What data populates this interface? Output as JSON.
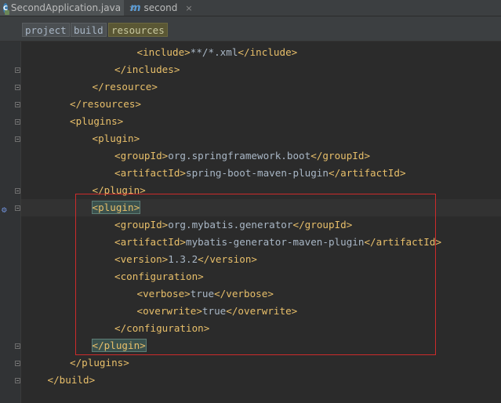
{
  "tabs": [
    {
      "label": "SecondApplication.java",
      "icon": "spring-class-icon",
      "close": "×",
      "active": true
    },
    {
      "label": "second",
      "icon": "maven-module-icon",
      "icon_glyph": "m",
      "close": "×",
      "active": false
    }
  ],
  "breadcrumb": [
    "project",
    "build",
    "resources"
  ],
  "code_lines": [
    {
      "indent": 5,
      "parts": [
        [
          "t",
          "<include>"
        ],
        [
          "x",
          "**/*.xml"
        ],
        [
          "t",
          "</include>"
        ]
      ]
    },
    {
      "indent": 4,
      "parts": [
        [
          "t",
          "</includes>"
        ]
      ]
    },
    {
      "indent": 3,
      "parts": [
        [
          "t",
          "</resource>"
        ]
      ]
    },
    {
      "indent": 2,
      "parts": [
        [
          "t",
          "</resources>"
        ]
      ]
    },
    {
      "indent": 2,
      "parts": [
        [
          "t",
          "<plugins>"
        ]
      ]
    },
    {
      "indent": 3,
      "parts": [
        [
          "t",
          "<plugin>"
        ]
      ]
    },
    {
      "indent": 4,
      "parts": [
        [
          "t",
          "<groupId>"
        ],
        [
          "x",
          "org.springframework.boot"
        ],
        [
          "t",
          "</groupId>"
        ]
      ]
    },
    {
      "indent": 4,
      "parts": [
        [
          "t",
          "<artifactId>"
        ],
        [
          "x",
          "spring-boot-maven-plugin"
        ],
        [
          "t",
          "</artifactId>"
        ]
      ]
    },
    {
      "indent": 3,
      "parts": [
        [
          "t",
          "</plugin>"
        ]
      ]
    },
    {
      "indent": 3,
      "parts": [
        [
          "h",
          "<plugin>"
        ]
      ]
    },
    {
      "indent": 4,
      "parts": [
        [
          "t",
          "<groupId>"
        ],
        [
          "x",
          "org.mybatis.generator"
        ],
        [
          "t",
          "</groupId>"
        ]
      ]
    },
    {
      "indent": 4,
      "parts": [
        [
          "t",
          "<artifactId>"
        ],
        [
          "x",
          "mybatis-generator-maven-plugin"
        ],
        [
          "t",
          "</artifactId>"
        ]
      ]
    },
    {
      "indent": 4,
      "parts": [
        [
          "t",
          "<version>"
        ],
        [
          "x",
          "1.3.2"
        ],
        [
          "t",
          "</version>"
        ]
      ]
    },
    {
      "indent": 4,
      "parts": [
        [
          "t",
          "<configuration>"
        ]
      ]
    },
    {
      "indent": 5,
      "parts": [
        [
          "t",
          "<verbose>"
        ],
        [
          "x",
          "true"
        ],
        [
          "t",
          "</verbose>"
        ]
      ]
    },
    {
      "indent": 5,
      "parts": [
        [
          "t",
          "<overwrite>"
        ],
        [
          "x",
          "true"
        ],
        [
          "t",
          "</overwrite>"
        ]
      ]
    },
    {
      "indent": 4,
      "parts": [
        [
          "t",
          "</configuration>"
        ]
      ]
    },
    {
      "indent": 3,
      "parts": [
        [
          "h",
          "</plugin>"
        ]
      ]
    },
    {
      "indent": 2,
      "parts": [
        [
          "t",
          "</plugins>"
        ]
      ]
    },
    {
      "indent": 1,
      "parts": [
        [
          "t",
          "</build>"
        ]
      ]
    }
  ],
  "caret_line": 9,
  "fold_markers": [
    1,
    2,
    3,
    4,
    5,
    8,
    9,
    17,
    18,
    19
  ],
  "colors": {
    "tag": "#e8bf6a",
    "text": "#a9b7c6",
    "highlight": "#cc2b2b"
  }
}
